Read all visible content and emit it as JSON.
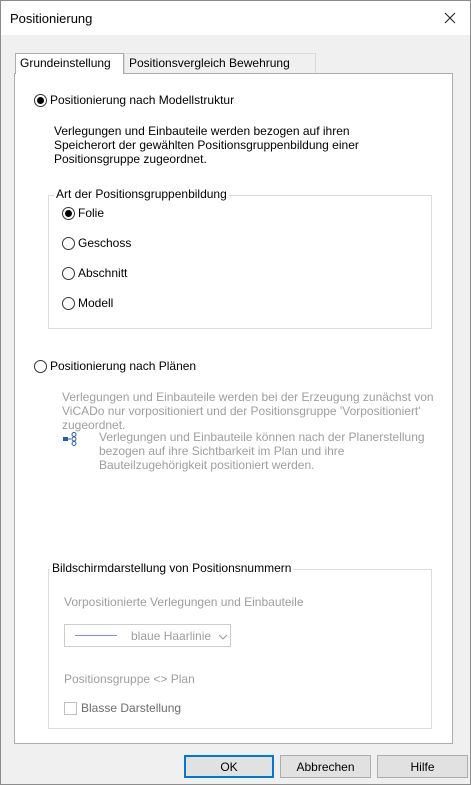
{
  "window": {
    "title": "Positionierung"
  },
  "tabs": [
    {
      "label": "Grundeinstellung"
    },
    {
      "label": "Positionsvergleich Bewehrung"
    }
  ],
  "option_model": {
    "label": "Positionierung nach Modellstruktur",
    "description": "Verlegungen und Einbauteile werden bezogen auf ihren Speicherort der gewählten Positionsgruppenbildung einer Positionsgruppe zugeordnet."
  },
  "group_type": {
    "label": "Art der Positionsgruppenbildung",
    "options": [
      "Folie",
      "Geschoss",
      "Abschnitt",
      "Modell"
    ],
    "selected": "Folie"
  },
  "option_plans": {
    "label": "Positionierung nach Plänen",
    "description": "Verlegungen und Einbauteile werden bei der Erzeugung zunächst von ViCADo nur vorpositioniert und der Positionsgruppe 'Vorpositioniert' zugeordnet.",
    "info": "Verlegungen und Einbauteile können nach der Planerstellung bezogen auf ihre Sichtbarkeit im Plan und ihre Bauteilzugehörigkeit positioniert werden.",
    "info_icon": "hierarchy-icon"
  },
  "display_group": {
    "label": "Bildschirmdarstellung von Positionsnummern",
    "prepositioned_label": "Vorpositionierte Verlegungen und Einbauteile",
    "line_style": "blaue Haarlinie",
    "line_color": "#8080ff",
    "group_plan_label": "Positionsgruppe <> Plan",
    "faded_label": "Blasse Darstellung"
  },
  "buttons": {
    "ok": "OK",
    "cancel": "Abbrechen",
    "help": "Hilfe"
  }
}
